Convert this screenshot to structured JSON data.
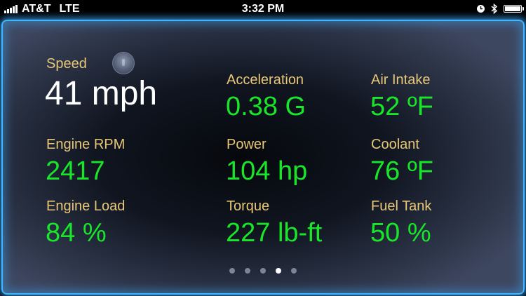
{
  "status_bar": {
    "carrier": "AT&T",
    "network": "LTE",
    "time": "3:32 PM"
  },
  "gauges": {
    "speed": {
      "label": "Speed",
      "value": "41 mph"
    },
    "acceleration": {
      "label": "Acceleration",
      "value": "0.38 G"
    },
    "air_intake": {
      "label": "Air Intake",
      "value": "52 ºF"
    },
    "engine_rpm": {
      "label": "Engine RPM",
      "value": "2417"
    },
    "power": {
      "label": "Power",
      "value": "104 hp"
    },
    "coolant": {
      "label": "Coolant",
      "value": "76 ºF"
    },
    "engine_load": {
      "label": "Engine Load",
      "value": "84 %"
    },
    "torque": {
      "label": "Torque",
      "value": "227 lb-ft"
    },
    "fuel_tank": {
      "label": "Fuel Tank",
      "value": "50 %"
    }
  },
  "page_indicator": {
    "pages": 5,
    "current": 4
  },
  "colors": {
    "label": "#e8c878",
    "value": "#19e62a",
    "primary_value": "#ffffff",
    "border_glow": "#3fb6ff"
  },
  "icons": {
    "status_indicator": "status-orb-icon",
    "signal": "signal-bars-icon",
    "clock": "clock-icon",
    "bluetooth": "bluetooth-icon",
    "battery": "battery-icon"
  }
}
